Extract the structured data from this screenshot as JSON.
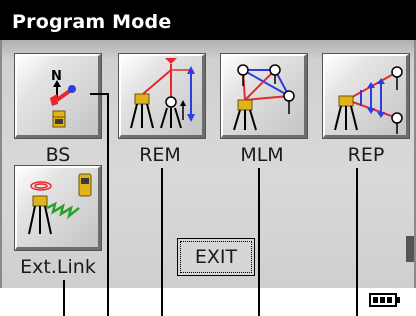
{
  "window": {
    "title": "Program Mode"
  },
  "buttons": [
    {
      "key": "bs",
      "label": "BS"
    },
    {
      "key": "rem",
      "label": "REM"
    },
    {
      "key": "mlm",
      "label": "MLM"
    },
    {
      "key": "rep",
      "label": "REP"
    },
    {
      "key": "ext_link",
      "label": "Ext.Link"
    }
  ],
  "exit": {
    "label": "EXIT"
  },
  "icons": {
    "bs": "backsight-station-icon",
    "rem": "remote-elevation-icon",
    "mlm": "missing-line-icon",
    "rep": "repetition-angle-icon",
    "ext_link": "external-link-icon",
    "battery": "battery-icon"
  },
  "status": {
    "battery_level": 1.0
  },
  "colors": {
    "titlebar": "#000000",
    "title_text": "#ffffff",
    "panel": "#d6d6d6",
    "accent_red": "#e8272b",
    "accent_blue": "#2d3ee0",
    "accent_green": "#2ca02c",
    "instrument_yellow": "#e0b21c"
  }
}
